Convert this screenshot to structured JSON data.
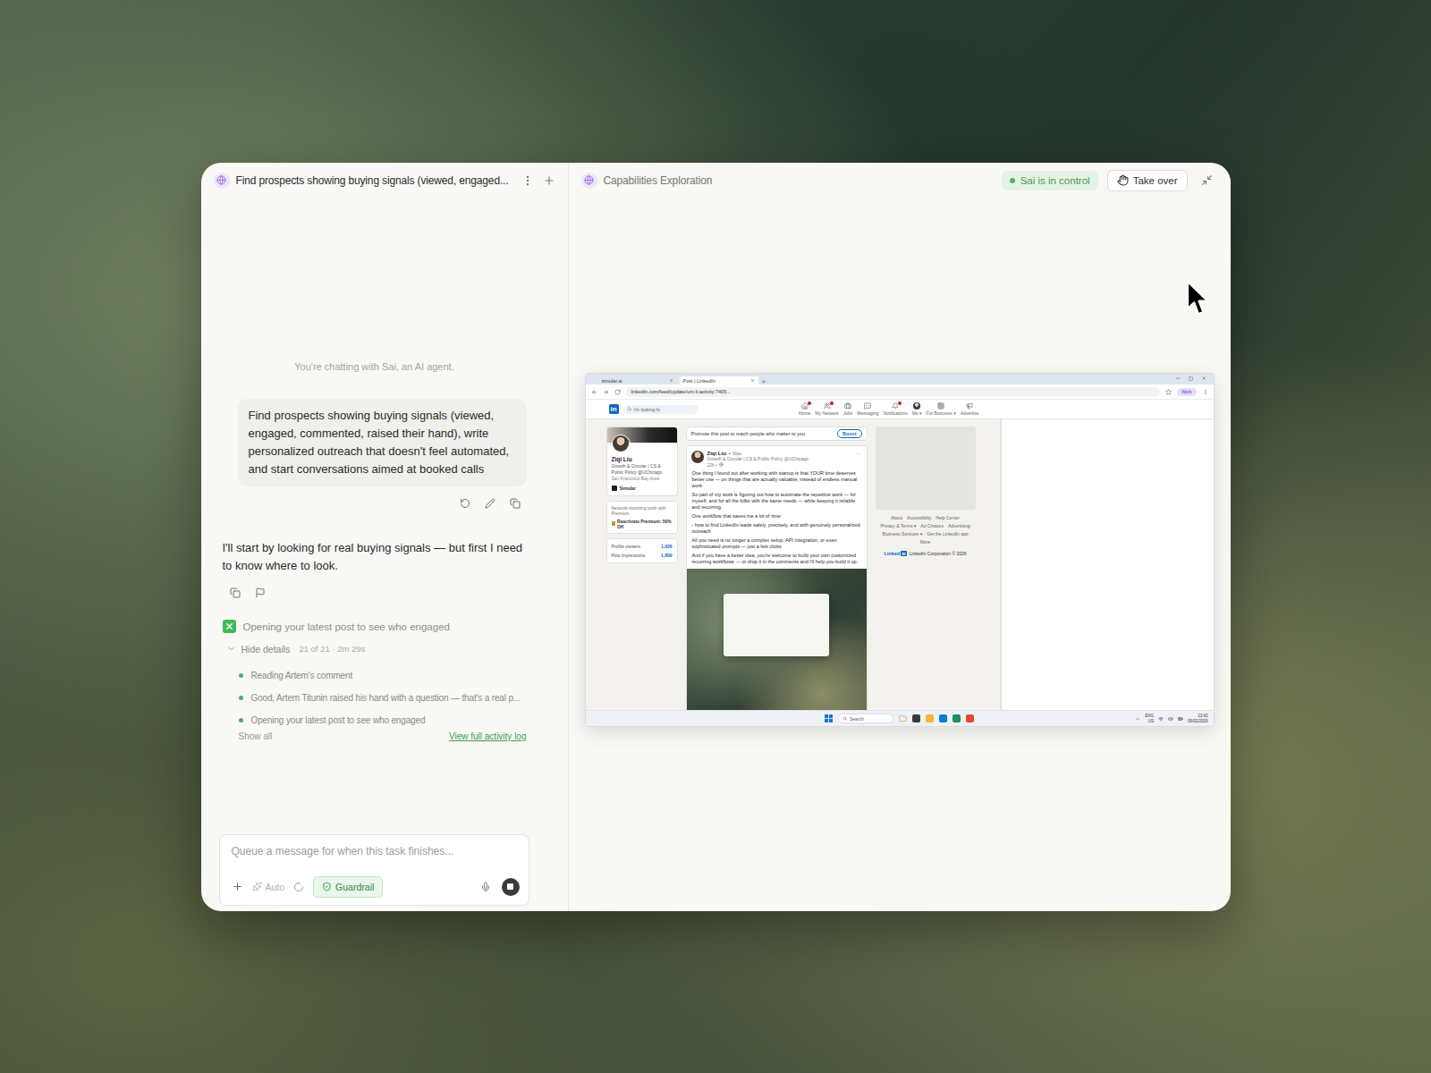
{
  "chat": {
    "title": "Find prospects showing buying signals (viewed, engaged...",
    "intro": "You're chatting with Sai, an AI agent.",
    "user_message": "Find prospects showing buying signals (viewed, engaged, commented, raised their hand), write personalized outreach that doesn't feel automated, and start conversations aimed at booked calls",
    "assistant_message": "I'll start by looking for real buying signals — but first I need to know where to look.",
    "task": {
      "status": "Opening your latest post to see who engaged",
      "toggle": "Hide details",
      "expanded": true,
      "progress": "21 of 21 · 2m 29s",
      "steps": [
        {
          "text": "Reading Artem's comment",
          "done": true
        },
        {
          "text": "Good, Artem Titunin raised his hand with a question — that's a real p...",
          "done": true
        },
        {
          "text": "Opening your latest post to see who engaged",
          "done": true
        }
      ],
      "show_all": "Show all",
      "activity_log": "View full activity log"
    }
  },
  "composer": {
    "placeholder": "Queue a message for when this task finishes...",
    "mode": "Auto",
    "mode_enabled": false,
    "running": true,
    "guardrail": "Guardrail",
    "guardrail_on": true
  },
  "agent_panel": {
    "title": "Capabilities Exploration",
    "status": "Sai is in control",
    "take_over": "Take over"
  },
  "remote_screen": {
    "browser": {
      "tabs": [
        {
          "label": "simular.ai",
          "selected": false
        },
        {
          "label": "Post | LinkedIn",
          "selected": true
        }
      ],
      "url": "linkedin.com/feed/update/urn:li:activity:7405...",
      "profile": "Work"
    },
    "linkedin": {
      "logo": "in",
      "search_placeholder": "I'm looking fo",
      "nav": [
        {
          "label": "Home",
          "kind": "icon",
          "badge": true
        },
        {
          "label": "My Network",
          "kind": "icon",
          "badge": true
        },
        {
          "label": "Jobs",
          "kind": "icon",
          "badge": false
        },
        {
          "label": "Messaging",
          "kind": "icon",
          "badge": false
        },
        {
          "label": "Notifications",
          "kind": "icon",
          "badge": true
        },
        {
          "label": "Me ▾",
          "kind": "avatar",
          "badge": false
        },
        {
          "label": "For Business ▾",
          "kind": "icon",
          "badge": false
        },
        {
          "label": "Advertise",
          "kind": "icon",
          "badge": false
        }
      ],
      "profile_card": {
        "name": "Ziqi Liu",
        "headline": "Growth & Circular | CS & Public Policy @UChicago",
        "location": "San Francisco Bay Area",
        "company": "Simular"
      },
      "premium": {
        "line1": "Network-boosting tools with Premium",
        "line2": "Reactivate Premium: 50% Off"
      },
      "stats": [
        {
          "label": "Profile viewers",
          "value": "1,026"
        },
        {
          "label": "Post impressions",
          "value": "1,809"
        }
      ],
      "promote": {
        "text": "Promote this post to reach people who matter to you",
        "button": "Boost"
      },
      "post": {
        "author": "Ziqi Liu",
        "degree": "• You",
        "headline": "Growth & Circular | CS & Public Policy @UChicago",
        "time": "22h •",
        "menu": "···",
        "paragraphs": [
          "One thing I found out after working with startup is that YOUR time deserves better use — on things that are actually valuable, instead of endless manual work.",
          "So part of my work is figuring out how to automate the repetitive work — for myself, and for all the folks with the same needs — while keeping it reliable and recurring.",
          "One workflow that saves me a lot of time:",
          "- how to find LinkedIn leads safely, precisely, and with genuinely personalized outreach",
          "All you need is no longer a complex setup, API integration, or even sophisticated prompts — just a few clicks",
          "And if you have a better idea, you're welcome to build your own customized recurring workflows — or drop it in the comments and I'll help you build it up."
        ]
      },
      "footer_links": [
        "About",
        "Accessibility",
        "Help Center",
        "Privacy & Terms ▾",
        "Ad Choices",
        "Advertising",
        "Business Services ▾",
        "Get the LinkedIn app",
        "More"
      ],
      "footer_logo": "Linked",
      "footer_logo_box": "in",
      "copyright": "LinkedIn Corporation © 2026"
    },
    "taskbar": {
      "search": "Search",
      "language": "ENG",
      "region": "US",
      "time": "13:42",
      "date": "06/02/2026"
    }
  }
}
